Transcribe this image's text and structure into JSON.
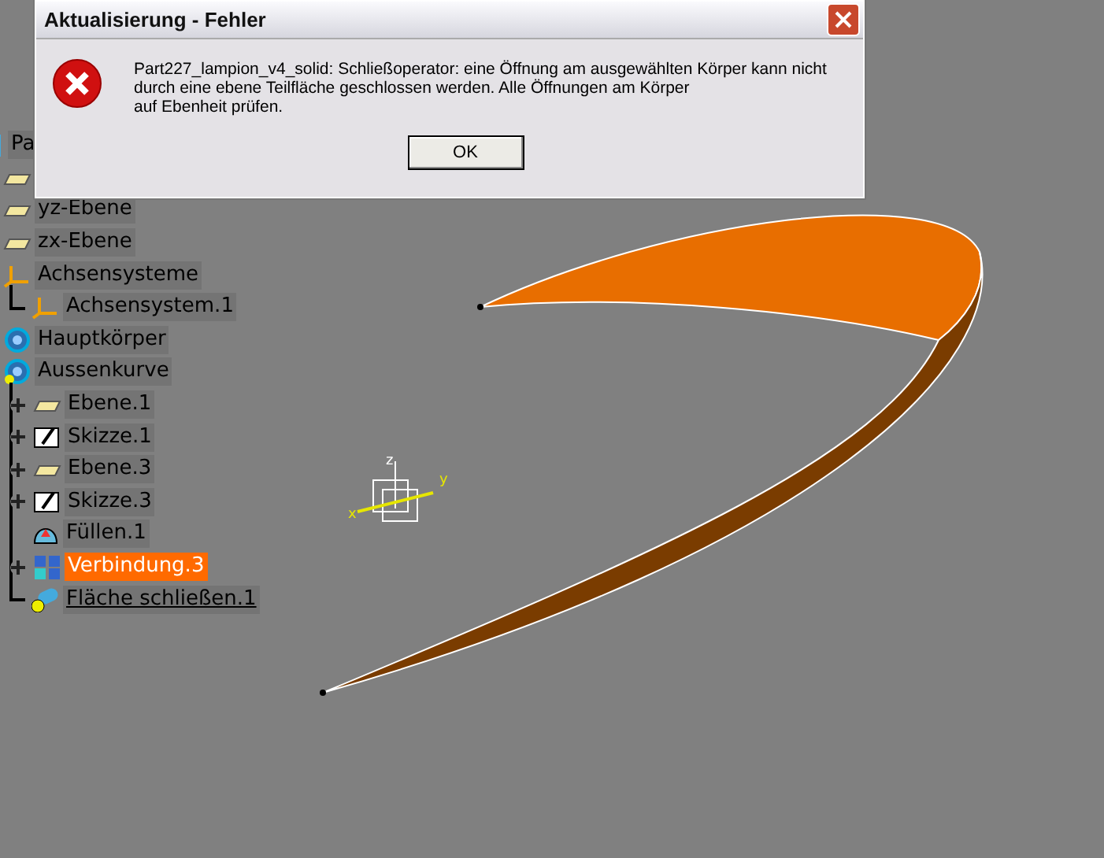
{
  "dialog": {
    "title": "Aktualisierung - Fehler",
    "message_lines": [
      "Part227_lampion_v4_solid: Schließoperator: eine Öffnung am ausgewählten Körper kann nicht",
      "durch eine ebene Teilfläche geschlossen werden. Alle Öffnungen am Körper",
      "auf Ebenheit prüfen."
    ],
    "buttons": [
      "OK"
    ]
  },
  "tree": {
    "items": [
      {
        "label": "Pa",
        "kind": "part",
        "selected": false,
        "underlined": false
      },
      {
        "kind": "plane"
      },
      {
        "label": "yz-Ebene",
        "kind": "plane",
        "selected": false,
        "underlined": false
      },
      {
        "label": "zx-Ebene",
        "kind": "plane",
        "selected": false,
        "underlined": false
      },
      {
        "label": "Achsensysteme",
        "kind": "axis",
        "selected": false,
        "underlined": false,
        "children": [
          {
            "label": "Achsensystem.1",
            "kind": "axis",
            "selected": false,
            "underlined": false,
            "expandable": false
          }
        ]
      },
      {
        "label": "Hauptkörper",
        "kind": "body",
        "selected": false,
        "underlined": false
      },
      {
        "label": "Aussenkurve",
        "kind": "geoset",
        "selected": false,
        "underlined": false,
        "children": [
          {
            "label": "Ebene.1",
            "kind": "plane",
            "selected": false,
            "underlined": false,
            "expandable": true
          },
          {
            "label": "Skizze.1",
            "kind": "sketch",
            "selected": false,
            "underlined": false,
            "expandable": true
          },
          {
            "label": "Ebene.3",
            "kind": "plane",
            "selected": false,
            "underlined": false,
            "expandable": true
          },
          {
            "label": "Skizze.3",
            "kind": "sketch",
            "selected": false,
            "underlined": false,
            "expandable": true
          },
          {
            "label": "Füllen.1",
            "kind": "fill",
            "selected": false,
            "underlined": false,
            "expandable": false
          },
          {
            "label": "Verbindung.3",
            "kind": "join",
            "selected": true,
            "underlined": false,
            "expandable": true
          },
          {
            "label": "Fläche schließen.1",
            "kind": "close",
            "selected": false,
            "underlined": true,
            "expandable": false
          }
        ]
      }
    ]
  },
  "compass": {
    "axis_labels": [
      "z",
      "y",
      "x"
    ]
  }
}
